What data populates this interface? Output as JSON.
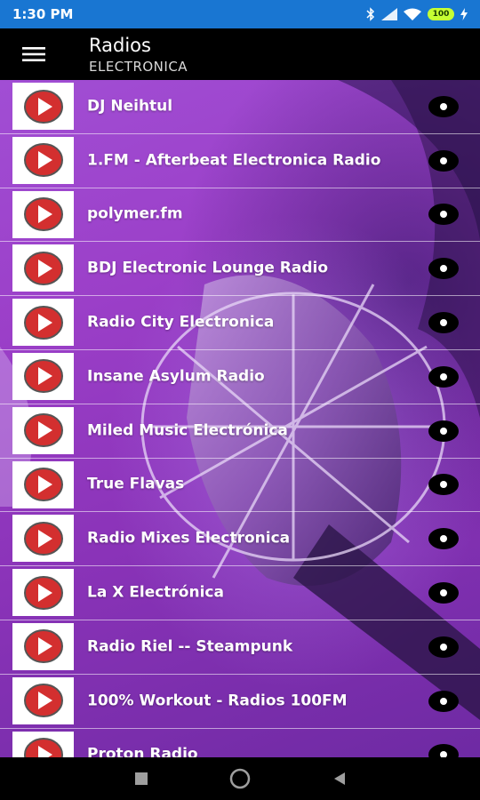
{
  "status_bar": {
    "time": "1:30 PM",
    "battery": "100"
  },
  "app_bar": {
    "title": "Radios",
    "subtitle": "ELECTRONICA"
  },
  "stations": [
    {
      "name": "DJ Neihtul"
    },
    {
      "name": "1.FM - Afterbeat Electronica Radio"
    },
    {
      "name": "polymer.fm"
    },
    {
      "name": "BDJ Electronic Lounge Radio"
    },
    {
      "name": "Radio City Electronica"
    },
    {
      "name": "Insane Asylum Radio"
    },
    {
      "name": "Miled Music Electrónica"
    },
    {
      "name": "True Flavas"
    },
    {
      "name": "Radio Mixes Electronica"
    },
    {
      "name": "La X Electrónica"
    },
    {
      "name": "Radio Riel -- Steampunk"
    },
    {
      "name": "100% Workout - Radios 100FM"
    },
    {
      "name": "Proton Radio"
    }
  ],
  "colors": {
    "status_bar": "#1976d2",
    "app_bar": "#000000",
    "play_icon_red": "#d32f2f",
    "battery": "#c6ff33"
  },
  "icons": {
    "menu": "hamburger-menu-icon",
    "play": "play-icon",
    "bluetooth": "bluetooth-icon",
    "signal": "signal-icon",
    "wifi": "wifi-icon",
    "charging": "charging-icon",
    "nav_recents": "square-recents-icon",
    "nav_home": "circle-home-icon",
    "nav_back": "triangle-back-icon"
  }
}
